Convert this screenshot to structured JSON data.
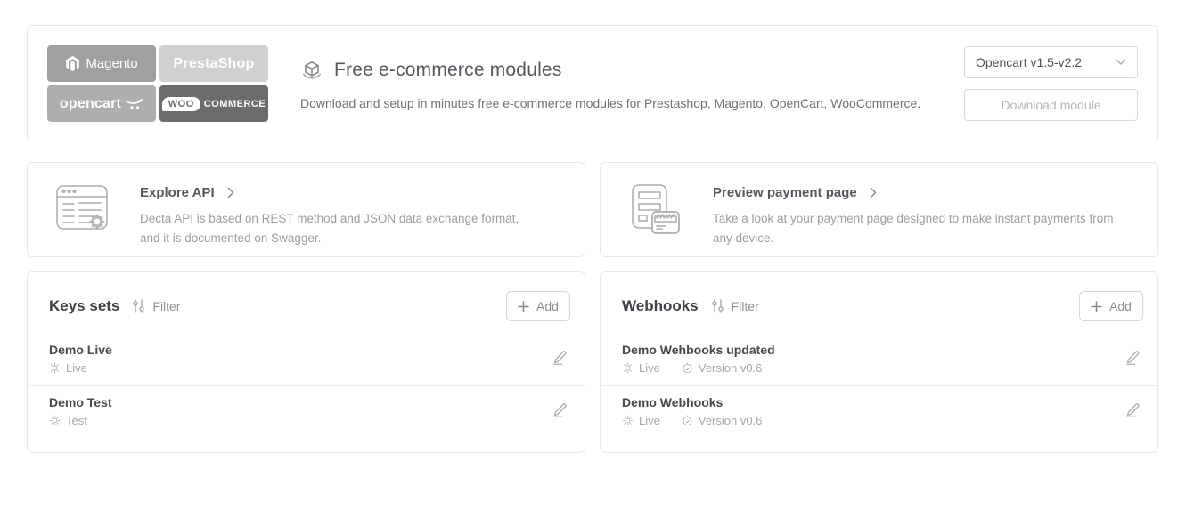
{
  "modules_card": {
    "logos": {
      "magento": "Magento",
      "prestashop": "PrestaShop",
      "opencart": "opencart",
      "woocommerce_badge": "WOO",
      "woocommerce_rest": "COMMERCE"
    },
    "title": "Free e-commerce modules",
    "description": "Download and setup in minutes free e-commerce modules for Prestashop, Magento, OpenCart, WooCommerce.",
    "version_selected": "Opencart v1.5-v2.2",
    "download_label": "Download module"
  },
  "explore_api": {
    "title": "Explore API",
    "description": "Decta API is based on REST method and JSON data exchange format, and it is documented on Swagger."
  },
  "preview_payment": {
    "title": "Preview payment page",
    "description": "Take a look at your payment page designed to make instant payments from any device."
  },
  "keys_sets": {
    "title": "Keys sets",
    "filter_label": "Filter",
    "add_label": "Add",
    "items": [
      {
        "name": "Demo Live",
        "mode": "Live"
      },
      {
        "name": "Demo Test",
        "mode": "Test"
      }
    ]
  },
  "webhooks": {
    "title": "Webhooks",
    "filter_label": "Filter",
    "add_label": "Add",
    "items": [
      {
        "name": "Demo Wehbooks updated",
        "mode": "Live",
        "version": "Version v0.6"
      },
      {
        "name": "Demo Webhooks",
        "mode": "Live",
        "version": "Version v0.6"
      }
    ]
  }
}
